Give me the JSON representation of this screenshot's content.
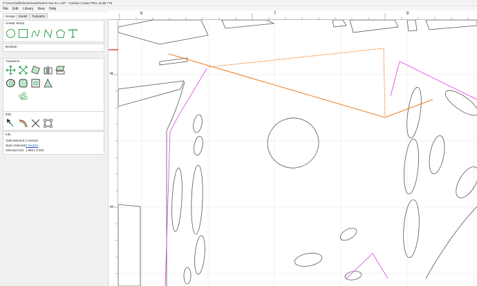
{
  "window": {
    "title": "C:\\Users\\wilfe\\Downloads\\brand new hrc.c2d* - Carbide Create PRO, Build 778"
  },
  "menu": {
    "file": "File",
    "edit": "Edit",
    "library": "Library",
    "view": "View",
    "help": "Help"
  },
  "tabs": {
    "design": "Design",
    "model": "Model",
    "toolpaths": "Toolpaths",
    "active": "design"
  },
  "panels": {
    "create_vector": "Create Vector",
    "boolean": "Boolean",
    "transform": "Transform",
    "edit": "Edit",
    "info": "Info"
  },
  "info": {
    "total_selected_label": "Total Selected:",
    "total_selected_value": "2 Vectors",
    "open_selected_label": "Open Selected:",
    "open_selected_value": "2 Vectors",
    "selected_size_label": "Selected Size:",
    "selected_size_value": "1.980 x 0.319"
  },
  "ruler": {
    "top_labels": [
      "6",
      "7",
      "8"
    ],
    "left_labels": [
      "6",
      "5"
    ]
  },
  "icons": {
    "create": [
      "circle-icon",
      "rectangle-icon",
      "curve-icon",
      "polyline-icon",
      "polygon-icon",
      "text-icon"
    ],
    "transform": [
      "move-icon",
      "scale-icon",
      "rotate-icon",
      "mirror-icon",
      "align-icon",
      "offset-icon",
      "fillet-icon",
      "group-icon",
      "join-icon",
      "distribute-icon"
    ],
    "edit": [
      "node-edit-icon",
      "trim-icon",
      "cut-icon",
      "bounding-box-icon"
    ]
  },
  "colors": {
    "accent_green": "#2e9e4a",
    "selection_orange": "#f07a1a",
    "magenta_path": "#e040e0",
    "vector_gray": "#555555",
    "ruler_red": "#d62020"
  }
}
